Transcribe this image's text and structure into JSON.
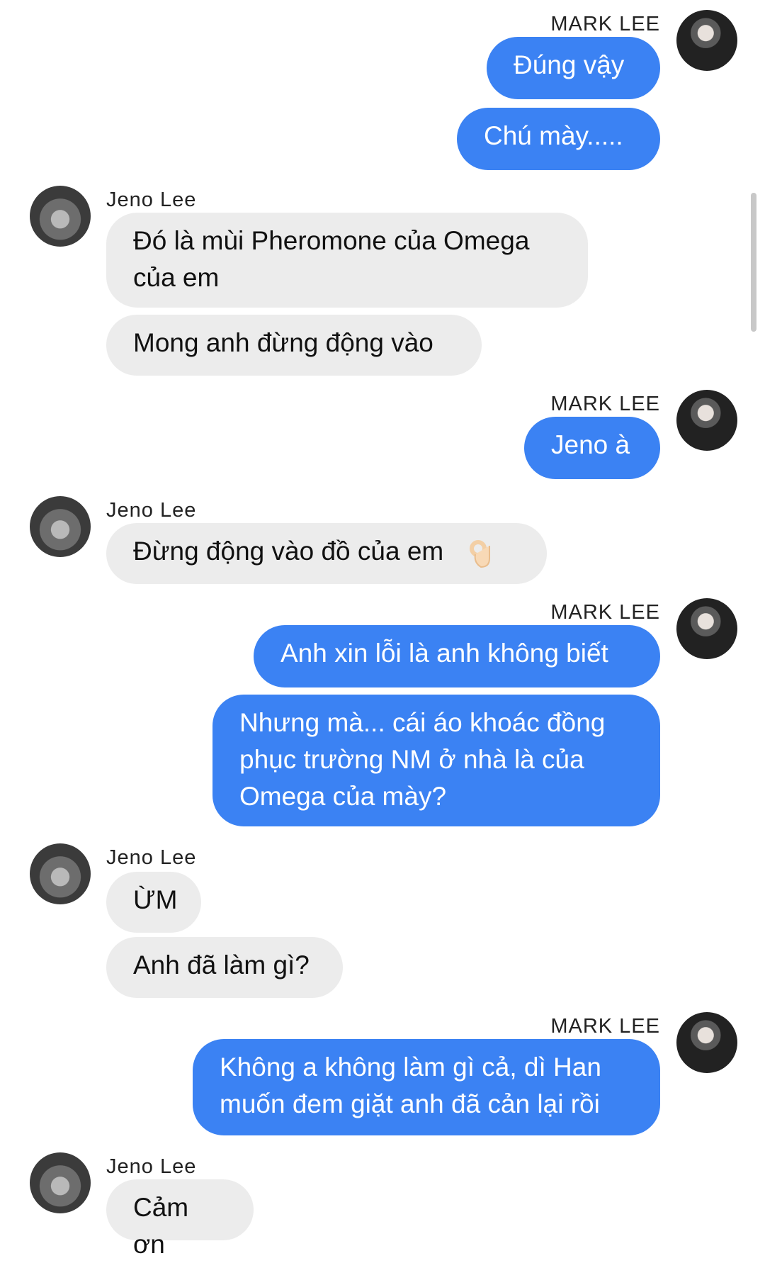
{
  "conversation": {
    "sender_names": {
      "outgoing": "MARK LEE",
      "incoming": "Jeno Lee"
    },
    "messages": [
      {
        "from": "MARK LEE",
        "text": "Đúng vậy"
      },
      {
        "from": "MARK LEE",
        "text": "Chú mày....."
      },
      {
        "from": "Jeno Lee",
        "text": "Đó là mùi Pheromone của Omega của em"
      },
      {
        "from": "Jeno Lee",
        "text": "Mong anh đừng động vào"
      },
      {
        "from": "MARK LEE",
        "text": "Jeno à"
      },
      {
        "from": "Jeno Lee",
        "text": "Đừng động vào đồ của em"
      },
      {
        "from": "MARK LEE",
        "text": "Anh xin lỗi là anh không biết"
      },
      {
        "from": "MARK LEE",
        "text": "Nhưng mà... cái áo khoác đồng phục trường NM  ở nhà là của Omega của mày?"
      },
      {
        "from": "Jeno Lee",
        "text": "ỪM"
      },
      {
        "from": "Jeno Lee",
        "text": "Anh đã làm gì?"
      },
      {
        "from": "MARK LEE",
        "text": "Không a không làm gì cả, dì Han muốn đem giặt  anh đã cản lại rồi"
      },
      {
        "from": "Jeno Lee",
        "text": "Cảm ơn"
      }
    ],
    "emoji": "ok-hand-emoji"
  },
  "colors": {
    "outgoing_bubble": "#3b82f3",
    "incoming_bubble": "#ececec"
  }
}
